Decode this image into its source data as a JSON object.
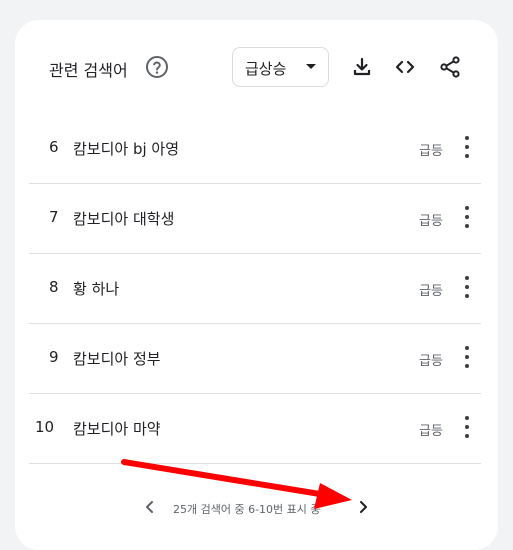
{
  "header": {
    "title": "관련 검색어",
    "select_value": "급상승"
  },
  "icons": {
    "help": "help-circle-icon",
    "download": "download-icon",
    "embed": "code-embed-icon",
    "share": "share-icon"
  },
  "rows": [
    {
      "num": "6",
      "term": "캄보디아 bj 아영",
      "status": "급등"
    },
    {
      "num": "7",
      "term": "캄보디아 대학생",
      "status": "급등"
    },
    {
      "num": "8",
      "term": "황 하나",
      "status": "급등"
    },
    {
      "num": "9",
      "term": "캄보디아 정부",
      "status": "급등"
    },
    {
      "num": "10",
      "term": "캄보디아 마약",
      "status": "급등"
    }
  ],
  "pager": {
    "text": "25개 검색어 중 6-10번 표시 중"
  },
  "colors": {
    "annotation_arrow": "#ff0000",
    "card": "#ffffff",
    "text": "#202124",
    "muted": "#5f6368"
  }
}
